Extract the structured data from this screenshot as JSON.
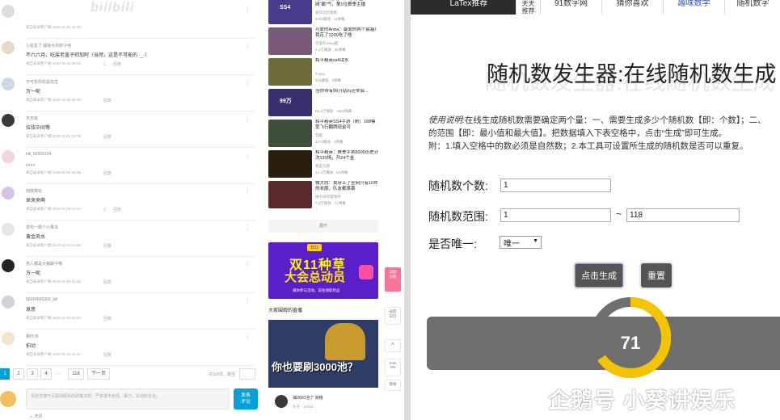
{
  "left": {
    "watermark": "bilibili",
    "comments": [
      {
        "name": "",
        "text": "",
        "meta": "来自安卓客户端 2019-11-04 21:40",
        "actions": ""
      },
      {
        "name": "小星星了 超级大的奶子哈",
        "text": "不六六月，吃屎老盖子帅加阿（当然，这是不可能的 ·_·）",
        "meta": "来自安卓客户端 2019-11-04 20:52",
        "actions": "1 回复"
      },
      {
        "name": "不可爱的松鼠先生",
        "text": "万一呢",
        "meta": "来自安卓客户端 2019-11-04 20:49",
        "actions": "回复"
      },
      {
        "name": "天天偷",
        "text": "拉弦中间等",
        "meta": "来自安卓客户端 2019-11-04 20:35",
        "actions": "回复"
      },
      {
        "name": "bili_65559164",
        "text": "。。。。",
        "meta": "来自安卓客户端 2019-11-04 16:05",
        "actions": "回复"
      },
      {
        "name": "彻底疯玩",
        "text": "来来来啊",
        "meta": "来自安卓客户端 2019-11-04 12:07",
        "actions": "1 回复"
      },
      {
        "name": "爱吃一颗个小果冻",
        "text": "黄金风水",
        "meta": "来自安卓客户端 2019-11-04 11:08",
        "actions": "回复"
      },
      {
        "name": "男人都是大猪蹄子哦",
        "text": "万一呢",
        "meta": "来自安卓客户端 2019-11-04 01:52",
        "actions": "回复"
      },
      {
        "name": "56656605302_bili",
        "text": "发意",
        "meta": "来自安卓客户端 2019-11-03 22:57",
        "actions": "回复"
      },
      {
        "name": "枫叶28",
        "text": "拍动",
        "meta": "来自安卓客户端 2019-11-03 22:37",
        "actions": "回复"
      }
    ],
    "pager": {
      "pages": [
        "1",
        "2",
        "3",
        "4",
        "...",
        "118",
        "下一页"
      ],
      "info": "共118页，跳至",
      "unit": "页"
    },
    "comment_placeholder": "请自觉遵守互联网相关的政策法规，严禁发布色情、暴力、反动的言论。",
    "send_label": "发表\n评论",
    "emoji_label": "表情"
  },
  "mid": {
    "videos": [
      {
        "title": "【和平精英】S54赛季金网\"霸\"气，第1位赛季主播",
        "sub": "爱欢玩的观看",
        "stat": "6784播放 · 11弹幕"
      },
      {
        "title": "可爱的Anna：最爱的两个套路！我花了1200吃了啥",
        "sub": "可爱的Anna超",
        "stat": "3.1万播放 · 28弹幕"
      },
      {
        "title": "和平精英ss4试水",
        "sub": "Tvass",
        "stat": "913播放 · 6弹幕"
      },
      {
        "title": "当你得有99万钻石还你会...",
        "sub": "",
        "stat": "56.6万播放 · 1864弹幕"
      },
      {
        "title": "和平精英SS4手游（刷）168模型飞行翻牌现金可",
        "sub": "忽酷",
        "stat": "2274播放 · 4弹幕"
      },
      {
        "title": "和平精英：赛季手柄5000历史计次130场，开24个金",
        "sub": "我是写题",
        "stat": "12.4万播放 · 64弹幕"
      },
      {
        "title": "微大白：我穿上了全网只有10件的衣服，队友都羡慕",
        "sub": "微大白的游戏吧",
        "stat": "7.2万播放 · 71弹幕"
      }
    ],
    "thumb_labels": [
      "SS4",
      "",
      "",
      "99万",
      "",
      "",
      ""
    ],
    "unfold_label": "展开",
    "ad": {
      "tag": "双11",
      "line1": "双11种草",
      "line2": "大会总动员",
      "line3": "邀你参与活动，前往领取奖品"
    },
    "live_header": "大家围观的直播",
    "live_big": "你也要刷3000池？",
    "live_user": "抽3000池了 滑稽",
    "live_meta": "九子 · 14716"
  },
  "floatbar": {
    "items": [
      "返回\n旧版",
      "返回\n日历",
      "^",
      "mini\nON",
      "客服"
    ]
  },
  "right": {
    "nav": [
      {
        "label": "LaTex推荐"
      },
      {
        "label": "天天\n推荐"
      },
      {
        "label": "91数字网"
      },
      {
        "label": "猜你喜欢"
      },
      {
        "label": "趣味数学"
      },
      {
        "label": "随机数字"
      }
    ],
    "title": "随机数发生器:在线随机数生成",
    "instructions": {
      "prefix": "使用说明:",
      "line1": "在线生成随机数需要确定两个量：一、需要生成多少个随机数【即：个数】；二、",
      "line2": "的范围【即：最小值和最大值】。把数据填入下表空格中，点击“生成”即可生成。",
      "line3": "附：1.填入空格中的数必须是自然数；2.本工具可设置所生成的随机数是否可以重复。"
    },
    "form": {
      "count_label": "随机数个数:",
      "count_value": "1",
      "range_label": "随机数范围:",
      "range_min": "1",
      "range_sep": "~",
      "range_max": "118",
      "unique_label": "是否唯一:",
      "unique_value": "唯一"
    },
    "buttons": {
      "generate": "点击生成",
      "reset": "重置"
    },
    "result": "71",
    "watermark": "企鹅号 小葵讲娱乐"
  },
  "colors": {
    "accent": "#00a1d6",
    "pink": "#fb7299",
    "ring": "#f5c400",
    "result_bar": "#6f6f6f"
  }
}
